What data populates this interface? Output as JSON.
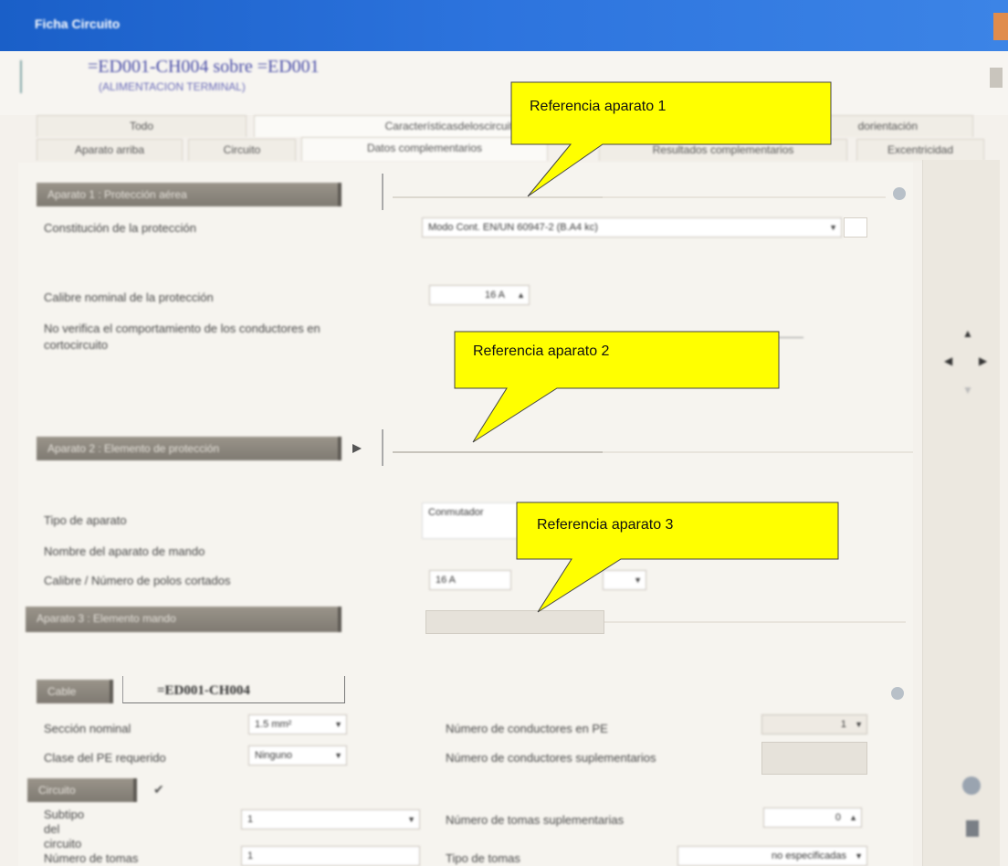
{
  "window": {
    "title": "Ficha Circuito",
    "colors": {
      "titlebar": "#2d74de",
      "callout_fill": "#ffff00",
      "section_bar": "#8a847a"
    }
  },
  "header": {
    "path": "=ED001-CH004 sobre =ED001",
    "subtitle": "(ALIMENTACION TERMINAL)",
    "icons": [
      "arrow-icon",
      "scroll-icon"
    ]
  },
  "tabs": {
    "row1": [
      "Todo",
      "Característicasdeloscircuitos",
      "dorientación"
    ],
    "row2": [
      "Aparato arriba",
      "Circuito",
      "Datos complementarios",
      "Resultados complementarios",
      "Excentricidad"
    ]
  },
  "sections": {
    "s1": "Aparato 1 : Protección aérea",
    "s2": "Aparato 2 : Elemento de protección",
    "s3": "Aparato 3 : Elemento mando",
    "cable": "Cable",
    "circuit": "Circuito"
  },
  "fields": {
    "proteccion_label": "Constitución de la protección",
    "proteccion_value": "Modo Cont. EN/UN 60947-2 (B.A4 kc)",
    "calibre_label": "Calibre nominal de la protección",
    "calibre_value": "16 A",
    "verifica_label_1": "No verifica el comportamiento de los conductores en",
    "verifica_label_2": "cortocircuito",
    "tipo_label": "Tipo de aparato",
    "tipo_value": "Conmutador",
    "nombre_label": "Nombre del aparato de mando",
    "calibre2_label": "Calibre / Número de polos cortados",
    "calibre2_value": "16 A",
    "cable_ref": "=ED001-CH004",
    "seccion_label": "Sección nominal",
    "seccion_value": "1.5 mm²",
    "clase_label": "Clase del PE requerido",
    "clase_value": "Ninguno",
    "numero_pe_label": "Número de conductores en PE",
    "numero_pe_value": "1",
    "numero_sup_label": "Número de conductores suplementarios",
    "subtipo_label": "Subtipo del circuito",
    "subtipo_value": "1",
    "numero_tomas_label": "Número de tomas suplementarias",
    "numero_tomas_value": "0",
    "numero_tomas2_label": "Número de tomas",
    "numero_tomas2_value": "1",
    "tipo_tomas_label": "Tipo de tomas",
    "tipo_tomas_value": "no especificadas"
  },
  "callouts": [
    {
      "text": "Referencia aparato 1"
    },
    {
      "text": "Referencia aparato 2"
    },
    {
      "text": "Referencia aparato 3"
    }
  ]
}
